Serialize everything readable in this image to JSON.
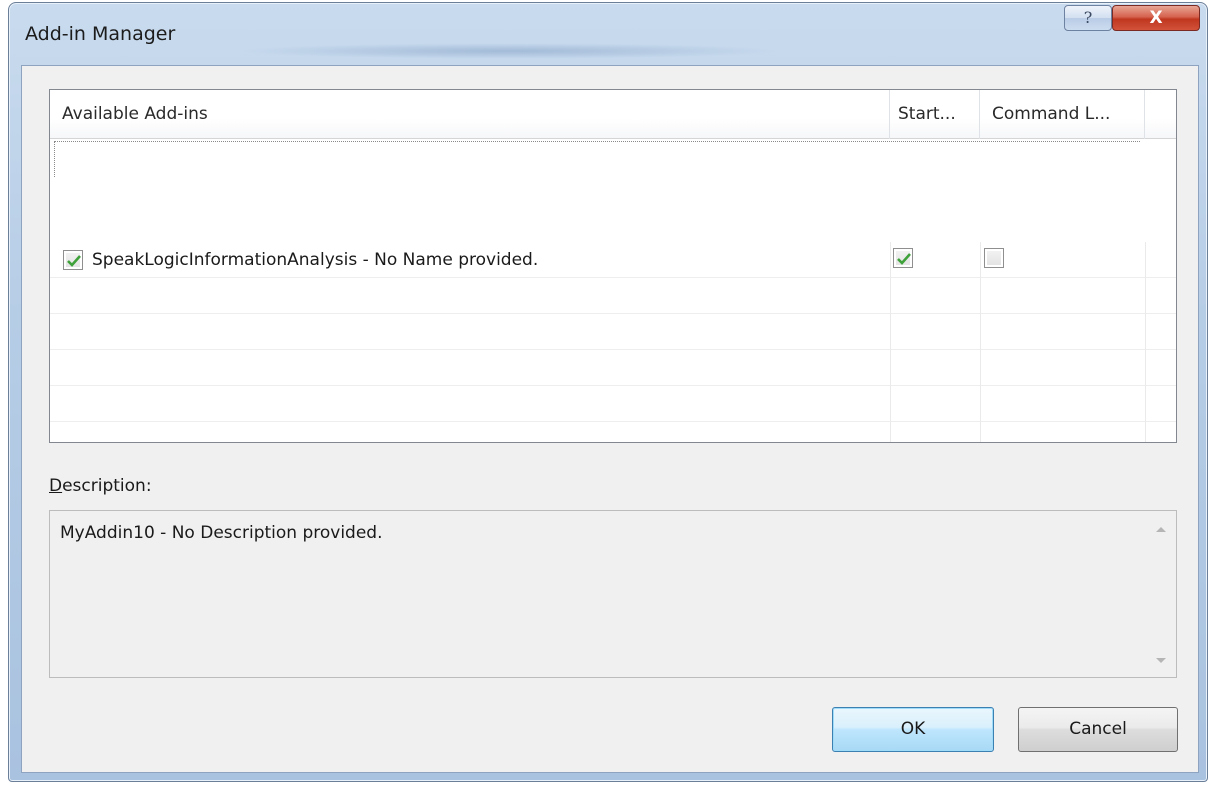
{
  "window": {
    "title": "Add-in Manager",
    "help_glyph": "?",
    "close_glyph": "X"
  },
  "addin_list": {
    "columns": [
      "Available Add-ins",
      "Start...",
      "Command L..."
    ],
    "rows": [
      {
        "name": "SpeakLogicInformationAnalysis - No Name provided.",
        "enabled": true,
        "startup": true,
        "command_line": false
      }
    ]
  },
  "description": {
    "label_accel": "D",
    "label_rest": "escription:",
    "text": "MyAddin10 - No Description provided."
  },
  "buttons": {
    "ok": "OK",
    "cancel": "Cancel"
  },
  "colors": {
    "check_green": "#3ea13a",
    "ok_border": "#3c7fb1"
  }
}
